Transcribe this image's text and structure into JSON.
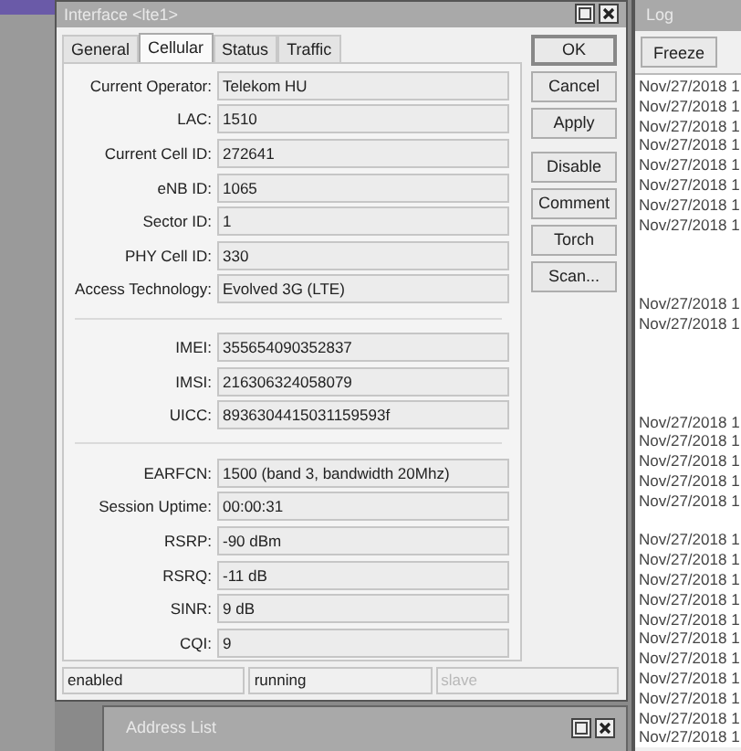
{
  "dialog": {
    "title": "Interface <lte1>",
    "tabs": [
      {
        "label": "General",
        "selected": false
      },
      {
        "label": "Cellular",
        "selected": true
      },
      {
        "label": "Status",
        "selected": false
      },
      {
        "label": "Traffic",
        "selected": false
      }
    ],
    "groups": [
      [
        {
          "label": "Current Operator:",
          "value": "Telekom HU"
        },
        {
          "label": "LAC:",
          "value": "1510"
        },
        {
          "label": "Current Cell ID:",
          "value": "272641"
        },
        {
          "label": "eNB ID:",
          "value": "1065"
        },
        {
          "label": "Sector ID:",
          "value": "1"
        },
        {
          "label": "PHY Cell ID:",
          "value": "330"
        },
        {
          "label": "Access Technology:",
          "value": "Evolved 3G (LTE)"
        }
      ],
      [
        {
          "label": "IMEI:",
          "value": "355654090352837"
        },
        {
          "label": "IMSI:",
          "value": "216306324058079"
        },
        {
          "label": "UICC:",
          "value": "8936304415031159593f"
        }
      ],
      [
        {
          "label": "EARFCN:",
          "value": "1500 (band 3, bandwidth 20Mhz)"
        },
        {
          "label": "Session Uptime:",
          "value": "00:00:31"
        },
        {
          "label": "RSRP:",
          "value": "-90 dBm"
        },
        {
          "label": "RSRQ:",
          "value": "-11 dB"
        },
        {
          "label": "SINR:",
          "value": "9 dB"
        },
        {
          "label": "CQI:",
          "value": "9"
        }
      ]
    ],
    "buttons": [
      "OK",
      "Cancel",
      "Apply",
      "Disable",
      "Comment",
      "Torch",
      "Scan..."
    ],
    "status_bar": [
      {
        "text": "enabled",
        "disabled": false
      },
      {
        "text": "running",
        "disabled": false
      },
      {
        "text": "slave",
        "disabled": true
      }
    ]
  },
  "log": {
    "title": "Log",
    "freeze": "Freeze",
    "entries": [
      {
        "kind": "entry",
        "text": "Nov/27/2018 1"
      },
      {
        "kind": "entry",
        "text": "Nov/27/2018 1"
      },
      {
        "kind": "entry",
        "text": "Nov/27/2018 1"
      },
      {
        "kind": "entry",
        "text": "Nov/27/2018 1"
      },
      {
        "kind": "entry",
        "text": "Nov/27/2018 1"
      },
      {
        "kind": "entry",
        "text": "Nov/27/2018 1"
      },
      {
        "kind": "entry",
        "text": "Nov/27/2018 1"
      },
      {
        "kind": "entry",
        "text": "Nov/27/2018 1"
      },
      {
        "kind": "blank"
      },
      {
        "kind": "blank"
      },
      {
        "kind": "blank"
      },
      {
        "kind": "entry",
        "text": "Nov/27/2018 1"
      },
      {
        "kind": "entry",
        "text": "Nov/27/2018 1"
      },
      {
        "kind": "blank"
      },
      {
        "kind": "blank"
      },
      {
        "kind": "blank"
      },
      {
        "kind": "blank"
      },
      {
        "kind": "entry",
        "text": "Nov/27/2018 1"
      },
      {
        "kind": "entry",
        "text": "Nov/27/2018 1"
      },
      {
        "kind": "entry",
        "text": "Nov/27/2018 1"
      },
      {
        "kind": "entry",
        "text": "Nov/27/2018 1"
      },
      {
        "kind": "entry",
        "text": "Nov/27/2018 1"
      },
      {
        "kind": "blank"
      },
      {
        "kind": "entry",
        "text": "Nov/27/2018 1"
      },
      {
        "kind": "entry",
        "text": "Nov/27/2018 1"
      },
      {
        "kind": "entry",
        "text": "Nov/27/2018 1"
      },
      {
        "kind": "entry",
        "text": "Nov/27/2018 1"
      },
      {
        "kind": "entry",
        "text": "Nov/27/2018 1"
      },
      {
        "kind": "entry",
        "text": "Nov/27/2018 1"
      },
      {
        "kind": "entry",
        "text": "Nov/27/2018 1"
      },
      {
        "kind": "entry",
        "text": "Nov/27/2018 1"
      },
      {
        "kind": "entry",
        "text": "Nov/27/2018 1"
      },
      {
        "kind": "entry",
        "text": "Nov/27/2018 1"
      },
      {
        "kind": "entry",
        "text": "Nov/27/2018 1"
      }
    ]
  },
  "address_list": {
    "title": "Address List"
  }
}
